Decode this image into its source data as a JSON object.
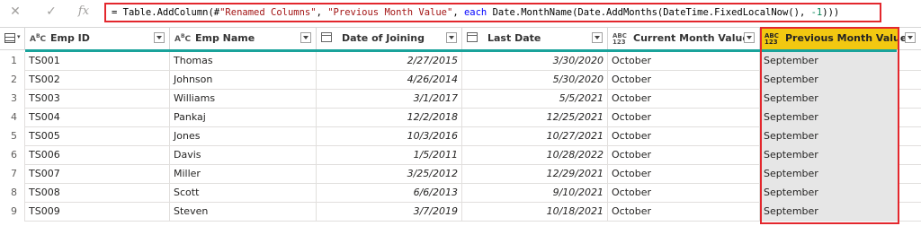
{
  "formula_bar": {
    "cancel_icon": "close-icon",
    "confirm_icon": "check-icon",
    "fx_label": "fx",
    "formula_prefix": "= Table.AddColumn(#",
    "formula_str1": "\"Renamed Columns\"",
    "formula_sep1": ", ",
    "formula_str2": "\"Previous Month Value\"",
    "formula_sep2": ", ",
    "formula_kw": "each",
    "formula_mid": " Date.MonthName(Date.AddMonths(DateTime.FixedLocalNow(), ",
    "formula_num": "-1",
    "formula_end": ")))"
  },
  "columns": [
    {
      "label": "Emp ID",
      "type_icon": "text-type-icon",
      "type_text": "A B C"
    },
    {
      "label": "Emp Name",
      "type_icon": "text-type-icon",
      "type_text": "A B C"
    },
    {
      "label": "Date of Joining",
      "type_icon": "date-type-icon",
      "type_text": ""
    },
    {
      "label": "Last Date",
      "type_icon": "date-type-icon",
      "type_text": ""
    },
    {
      "label": "Current Month Value",
      "type_icon": "any-type-icon",
      "type_text": "ABC 123"
    },
    {
      "label": "Previous Month Value",
      "type_icon": "any-type-icon",
      "type_text": "ABC 123"
    }
  ],
  "rows": [
    {
      "n": "1",
      "id": "TS001",
      "name": "Thomas",
      "join": "2/27/2015",
      "last": "3/30/2020",
      "cur": "October",
      "prev": "September"
    },
    {
      "n": "2",
      "id": "TS002",
      "name": "Johnson",
      "join": "4/26/2014",
      "last": "5/30/2020",
      "cur": "October",
      "prev": "September"
    },
    {
      "n": "3",
      "id": "TS003",
      "name": "Williams",
      "join": "3/1/2017",
      "last": "5/5/2021",
      "cur": "October",
      "prev": "September"
    },
    {
      "n": "4",
      "id": "TS004",
      "name": "Pankaj",
      "join": "12/2/2018",
      "last": "12/25/2021",
      "cur": "October",
      "prev": "September"
    },
    {
      "n": "5",
      "id": "TS005",
      "name": "Jones",
      "join": "10/3/2016",
      "last": "10/27/2021",
      "cur": "October",
      "prev": "September"
    },
    {
      "n": "6",
      "id": "TS006",
      "name": "Davis",
      "join": "1/5/2011",
      "last": "10/28/2022",
      "cur": "October",
      "prev": "September"
    },
    {
      "n": "7",
      "id": "TS007",
      "name": "Miller",
      "join": "3/25/2012",
      "last": "12/29/2021",
      "cur": "October",
      "prev": "September"
    },
    {
      "n": "8",
      "id": "TS008",
      "name": "Scott",
      "join": "6/6/2013",
      "last": "9/10/2021",
      "cur": "October",
      "prev": "September"
    },
    {
      "n": "9",
      "id": "TS009",
      "name": "Steven",
      "join": "3/7/2019",
      "last": "10/18/2021",
      "cur": "October",
      "prev": "September"
    }
  ],
  "colors": {
    "accent": "#f2c811",
    "highlight_border": "#e3272d",
    "quality_bar": "#1aa39b"
  }
}
